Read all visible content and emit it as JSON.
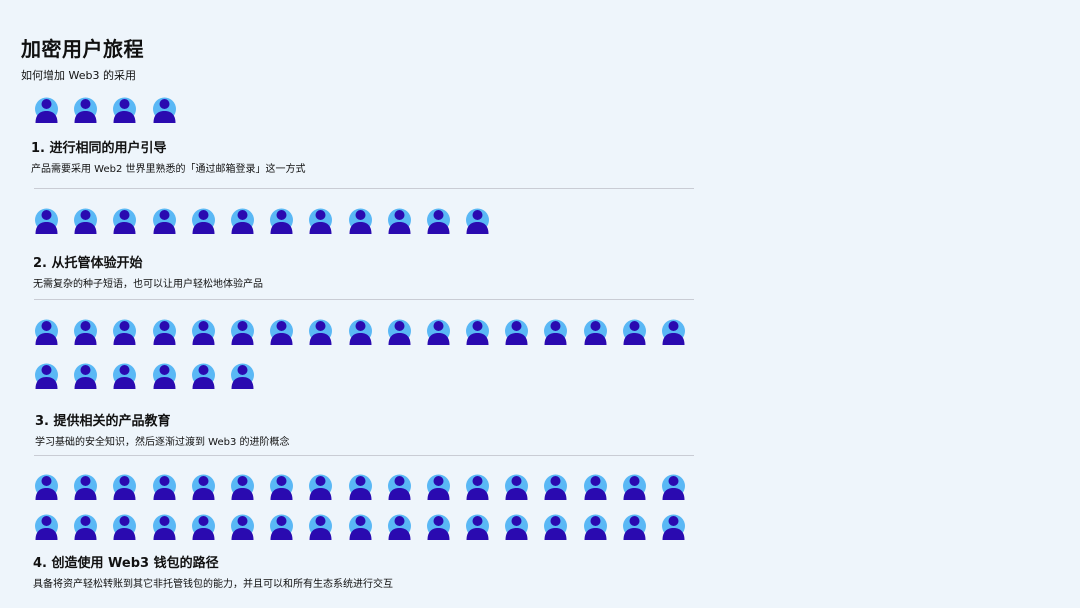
{
  "header": {
    "title": "加密用户旅程",
    "subtitle": "如何增加 Web3 的采用"
  },
  "steps": [
    {
      "title": "1.  进行相同的用户引导",
      "desc": "产品需要采用 Web2 世界里熟悉的「通过邮箱登录」这一方式",
      "icon_count": 4
    },
    {
      "title": "2. 从托管体验开始",
      "desc": "无需复杂的种子短语，也可以让用户轻松地体验产品",
      "icon_count": 12
    },
    {
      "title": "3. 提供相关的产品教育",
      "desc": "学习基础的安全知识，然后逐渐过渡到 Web3 的进阶概念",
      "icon_count": 23
    },
    {
      "title": "4. 创造使用 Web3 钱包的路径",
      "desc": "具备将资产轻松转账到其它非托管钱包的能力，并且可以和所有生态系统进行交互",
      "icon_count": 34
    }
  ],
  "colors": {
    "person_light": "#5ab8f5",
    "person_dark": "#2a0ab0",
    "divider": "#c9ccd4"
  },
  "icon_name": "person-icon"
}
